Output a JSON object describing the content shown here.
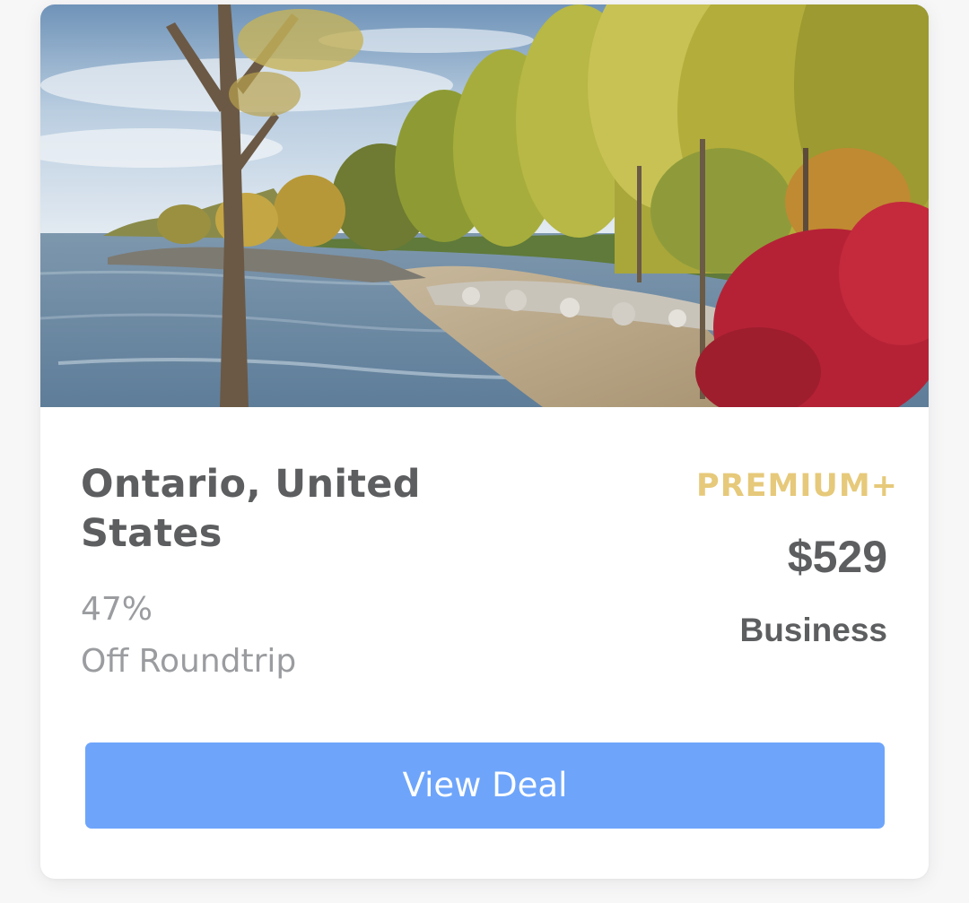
{
  "deal": {
    "destination": "Ontario, United States",
    "discount_percent": "47%",
    "discount_label": "Off Roundtrip",
    "tier": "PREMIUM+",
    "price": "$529",
    "cabin_class": "Business",
    "cta_label": "View Deal",
    "image_description": "lakeshore"
  },
  "colors": {
    "button": "#6ea5fb",
    "tier_gold": "#e6c97a",
    "heading_gray": "#5d5e60",
    "muted_gray": "#9a9c9f"
  }
}
